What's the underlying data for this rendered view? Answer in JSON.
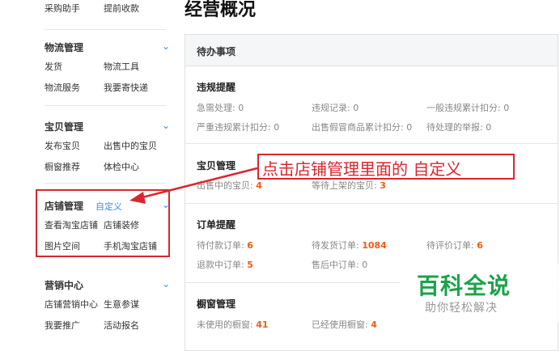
{
  "sidebar": {
    "top_links": [
      "采购助手",
      "提前收款"
    ],
    "logistics": {
      "title": "物流管理",
      "items": [
        "发货",
        "物流工具",
        "物流服务",
        "我要寄快递"
      ]
    },
    "products": {
      "title": "宝贝管理",
      "items": [
        "发布宝贝",
        "出售中的宝贝",
        "橱窗推荐",
        "体检中心"
      ]
    },
    "shop": {
      "title": "店铺管理",
      "custom": "自定义",
      "items": [
        "查看淘宝店铺",
        "店铺装修",
        "图片空间",
        "手机淘宝店铺"
      ]
    },
    "marketing": {
      "title": "营销中心",
      "items": [
        "店铺营销中心",
        "生意参谋",
        "我要推广",
        "活动报名"
      ]
    }
  },
  "main": {
    "title": "经营概况",
    "card_title": "待办事项",
    "violations": {
      "title": "违规提醒",
      "row1": [
        "急需处理: 0",
        "违规记录: 0",
        "一般违规累计扣分: 0"
      ],
      "row2": [
        "严重违规累计扣分: 0",
        "出售假冒商品累计扣分: 0",
        "待处理的举报: 0"
      ]
    },
    "products": {
      "title": "宝贝管理",
      "on_sale_label": "出售中的宝贝:",
      "on_sale": "4",
      "pending_label": "等待上架的宝贝:",
      "pending": "3"
    },
    "orders": {
      "title": "订单提醒",
      "unpaid_label": "待付款订单:",
      "unpaid": "6",
      "unshipped_label": "待发货订单:",
      "unshipped": "1084",
      "unrated_label": "待评价订单:",
      "unrated": "6",
      "refund_label": "退款中订单:",
      "refund": "5",
      "aftersale": "售后中订单: 0"
    },
    "window": {
      "title": "橱窗管理",
      "unused_label": "未使用的橱窗:",
      "unused": "41",
      "used_label": "已经使用橱窗:",
      "used": "4"
    }
  },
  "annotation": "点击店铺管理里面的 自定义",
  "watermark": {
    "title": "百科全说",
    "subtitle": "助你轻松解决"
  },
  "colors": {
    "accent": "#3a8ee6",
    "annotation": "#d9272e",
    "number": "#f05a14",
    "watermark": "#1aa34a"
  }
}
